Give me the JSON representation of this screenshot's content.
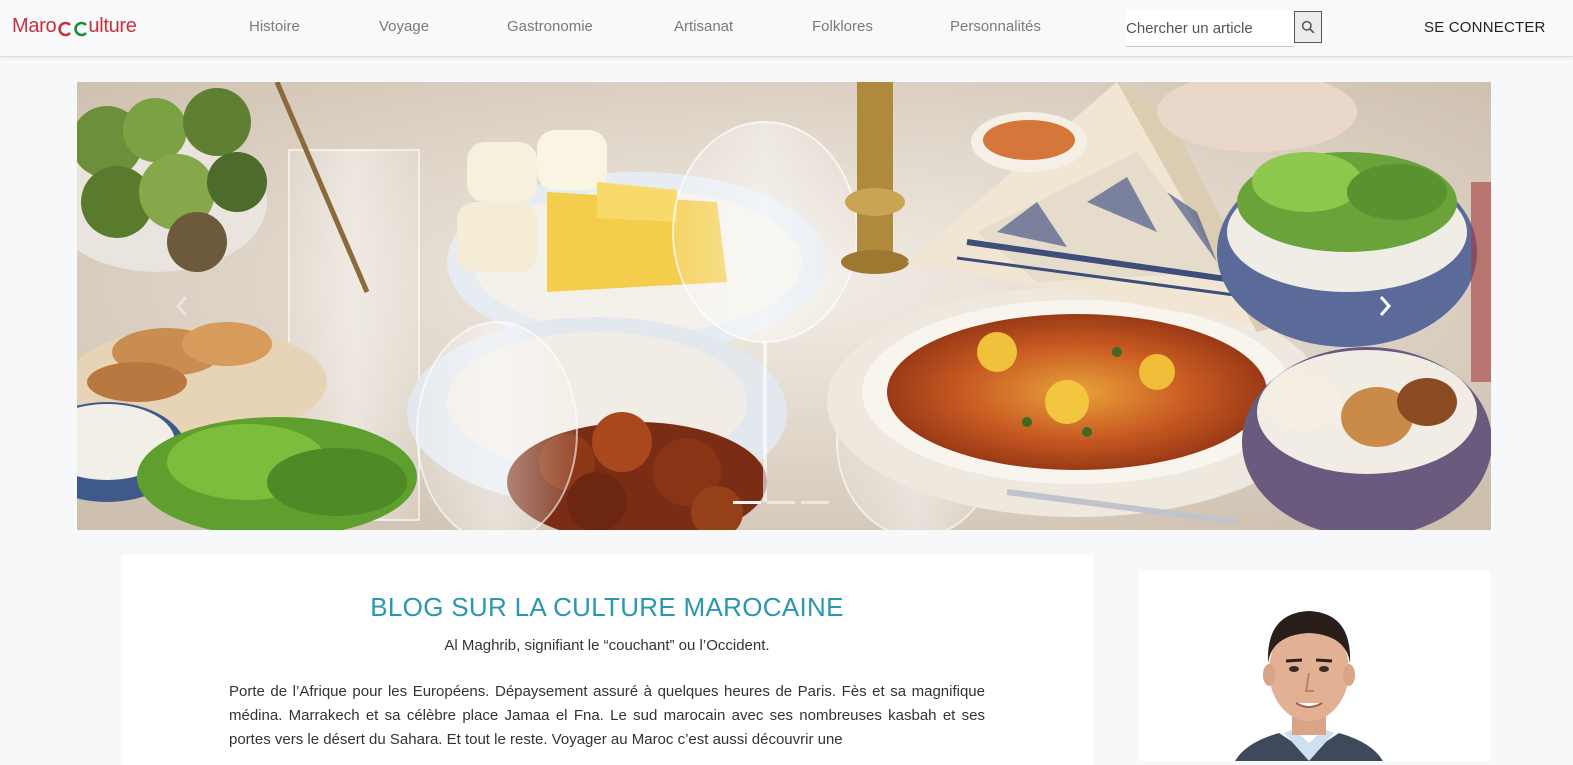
{
  "brand": {
    "part1": "Maro",
    "part2": "ulture"
  },
  "nav": {
    "links": [
      "Histoire",
      "Voyage",
      "Gastronomie",
      "Artisanat",
      "Folklores",
      "Personnalités"
    ],
    "search_placeholder": "Chercher un article",
    "login_label": "SE CONNECTER"
  },
  "carousel": {
    "slides": 3,
    "active_index": 0,
    "icons": {
      "prev": "chevron-left-icon",
      "next": "chevron-right-icon"
    }
  },
  "blog": {
    "title": "BLOG SUR LA CULTURE MAROCAINE",
    "subtitle": "Al Maghrib, signifiant le “couchant” ou l’Occident.",
    "body": "Porte de l’Afrique pour les Européens. Dépaysement assuré à quelques heures de Paris. Fès et sa magnifique médina. Marrakech et sa célèbre place Jamaa el Fna. Le sud marocain avec ses nombreuses kasbah et ses portes vers le désert du Sahara. Et tout le reste. Voyager au Maroc c’est aussi découvrir une"
  },
  "colors": {
    "brand_red": "#c8323e",
    "brand_green": "#1f8a3c",
    "title_teal": "#2a97b0",
    "nav_text": "#7a7a7a"
  }
}
